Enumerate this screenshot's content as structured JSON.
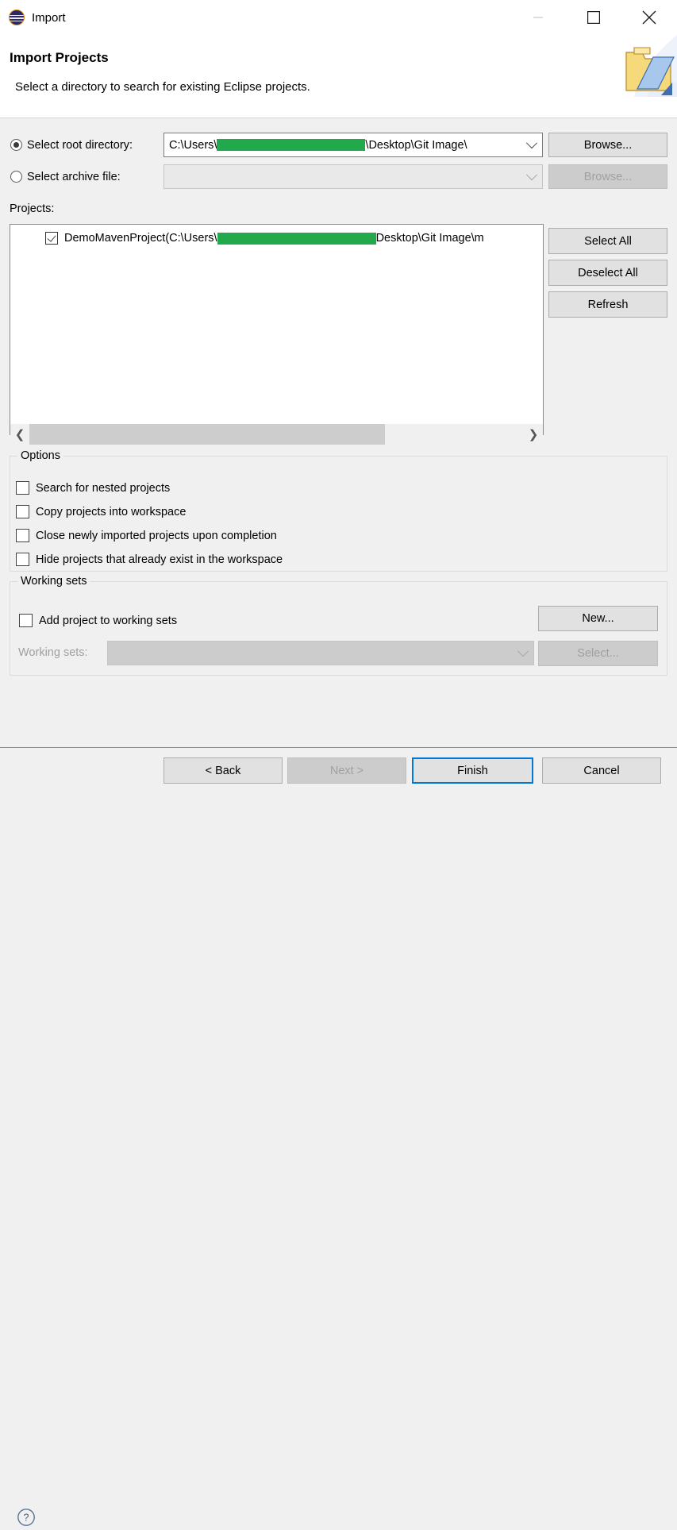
{
  "window": {
    "title": "Import",
    "icon": "eclipse-logo-icon",
    "controls": [
      {
        "name": "minimize",
        "glyph": "minimize-icon"
      },
      {
        "name": "maximize",
        "glyph": "maximize-icon"
      },
      {
        "name": "close",
        "glyph": "close-icon"
      }
    ]
  },
  "banner": {
    "title": "Import Projects",
    "description": "Select a directory to search for existing Eclipse projects.",
    "icon": "import-folder-icon"
  },
  "source": {
    "root_directory": {
      "label": "Select root directory:",
      "selected": true,
      "value_prefix": "C:\\Users\\",
      "value_suffix": "\\Desktop\\Git Image\\",
      "redacted": true,
      "browse_label": "Browse...",
      "browse_enabled": true
    },
    "archive_file": {
      "label": "Select archive file:",
      "selected": false,
      "value": "",
      "browse_label": "Browse...",
      "browse_enabled": false
    }
  },
  "projects": {
    "label": "Projects:",
    "items": [
      {
        "checked": true,
        "name": "DemoMavenProject",
        "path_prefix": " (C:\\Users\\",
        "path_suffix": "Desktop\\Git Image\\m",
        "redacted": true
      }
    ],
    "buttons": [
      {
        "label": "Select All",
        "enabled": true
      },
      {
        "label": "Deselect All",
        "enabled": true
      },
      {
        "label": "Refresh",
        "enabled": true
      }
    ],
    "scrollbar": {
      "left_arrow": "chevron-left-icon",
      "right_arrow": "chevron-right-icon"
    }
  },
  "options": {
    "title": "Options",
    "checkboxes": [
      {
        "label": "Search for nested projects",
        "checked": false
      },
      {
        "label": "Copy projects into workspace",
        "checked": false
      },
      {
        "label": "Close newly imported projects upon completion",
        "checked": false
      },
      {
        "label": "Hide projects that already exist in the workspace",
        "checked": false
      }
    ]
  },
  "working_sets": {
    "title": "Working sets",
    "add_checkbox": {
      "label": "Add project to working sets",
      "checked": false
    },
    "combo_label": "Working sets:",
    "combo_value": "",
    "combo_enabled": false,
    "new_button": {
      "label": "New...",
      "enabled": true
    },
    "select_button": {
      "label": "Select...",
      "enabled": false
    }
  },
  "footer": {
    "help_icon": "help-circle-icon",
    "buttons": [
      {
        "label": "< Back",
        "enabled": true,
        "default": false
      },
      {
        "label": "Next >",
        "enabled": false,
        "default": false
      },
      {
        "label": "Finish",
        "enabled": true,
        "default": true
      },
      {
        "label": "Cancel",
        "enabled": true,
        "default": false
      }
    ]
  },
  "colors": {
    "accent": "#0078d7",
    "redaction": "#22a94c",
    "dialog_bg": "#f0f0f0",
    "field_bg": "#ffffff"
  }
}
